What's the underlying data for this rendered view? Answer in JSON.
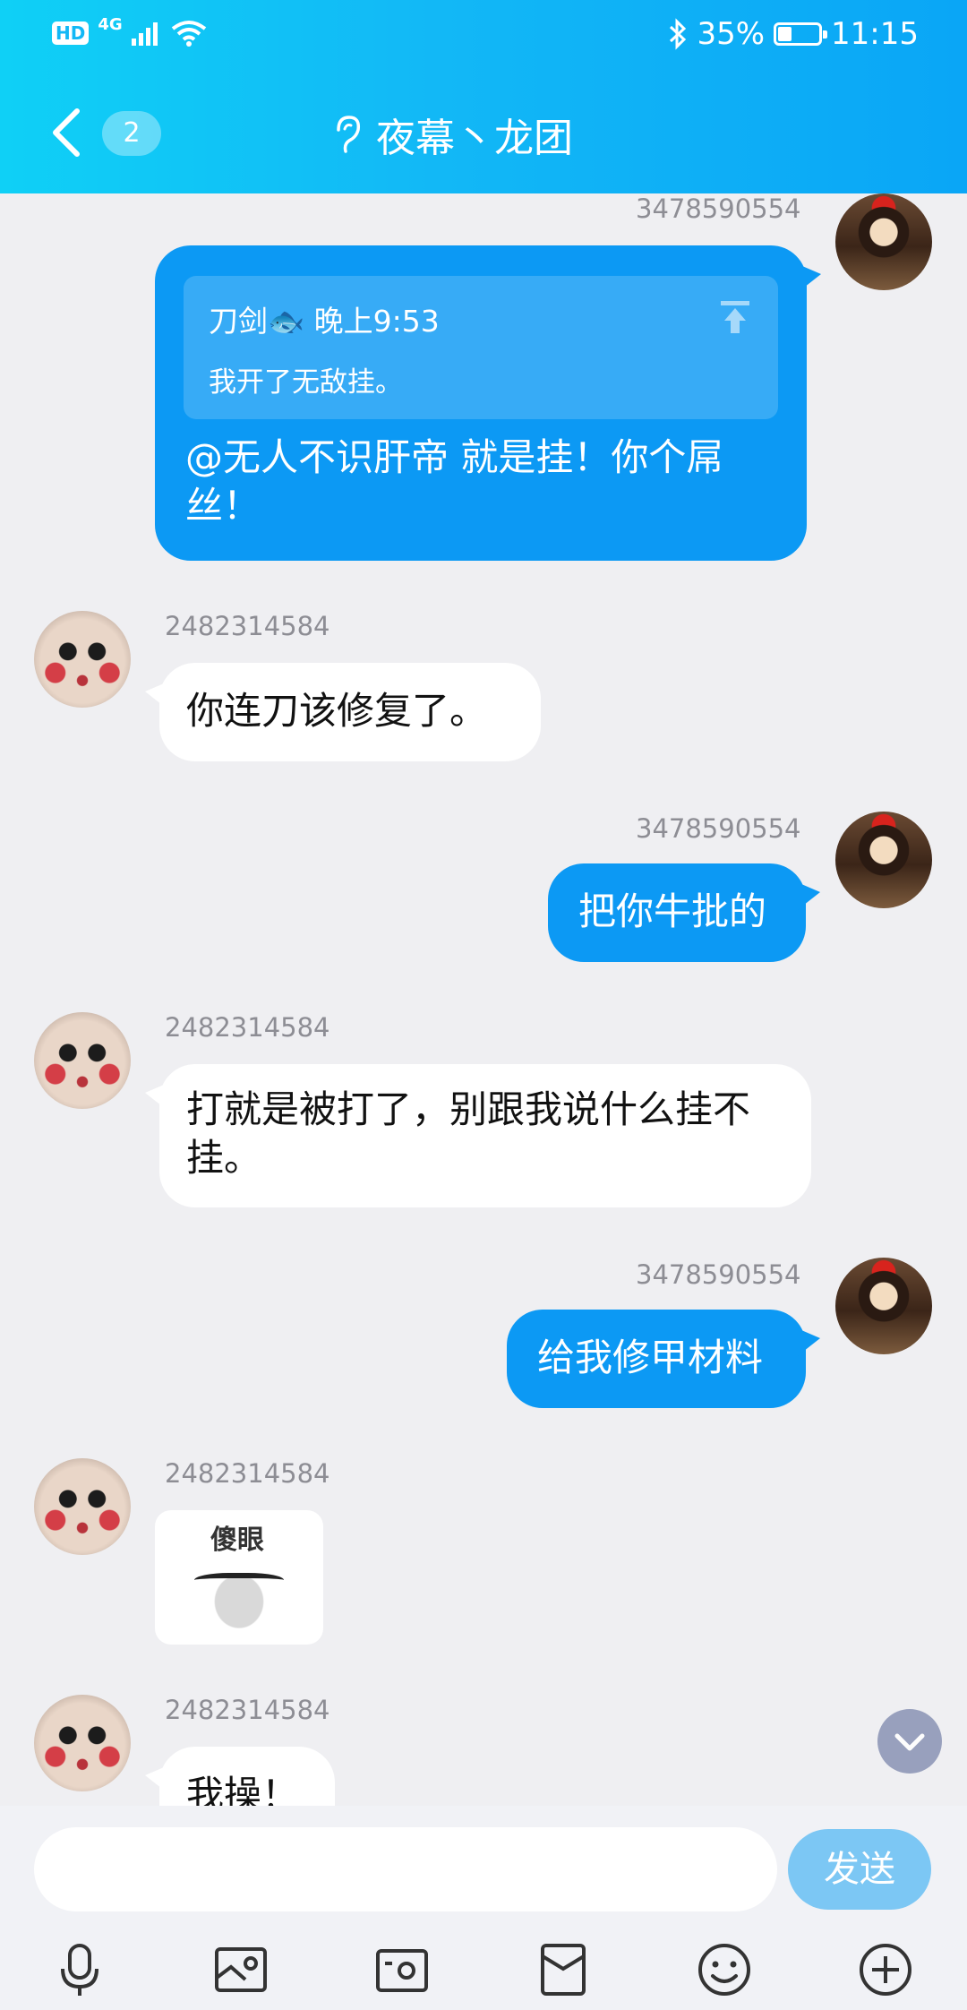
{
  "status_bar": {
    "hd": "HD",
    "network": "4G",
    "battery_percent": "35%",
    "battery_level": 0.35,
    "time": "11:15"
  },
  "header": {
    "unread_count": "2",
    "title": "夜幕丶龙团"
  },
  "messages": {
    "m1": {
      "sender_id": "3478590554",
      "quote_header": "刀剑🐟 晚上9:53",
      "quote_text": "我开了无敌挂。",
      "text": "@无人不识肝帝 就是挂！你个屌丝！"
    },
    "m2": {
      "sender_id": "2482314584",
      "text": "你连刀该修复了。"
    },
    "m3": {
      "sender_id": "3478590554",
      "text": "把你牛批的"
    },
    "m4": {
      "sender_id": "2482314584",
      "text": "打就是被打了，别跟我说什么挂不挂。"
    },
    "m5": {
      "sender_id": "3478590554",
      "text": "给我修甲材料"
    },
    "m6": {
      "sender_id": "2482314584",
      "sticker_text": "傻眼"
    },
    "m7": {
      "sender_id": "2482314584",
      "text": "我操！"
    }
  },
  "input": {
    "placeholder": "",
    "send_label": "发送"
  },
  "toolbar": [
    "microphone-icon",
    "image-icon",
    "camera-icon",
    "red-packet-icon",
    "emoji-icon",
    "plus-icon"
  ]
}
